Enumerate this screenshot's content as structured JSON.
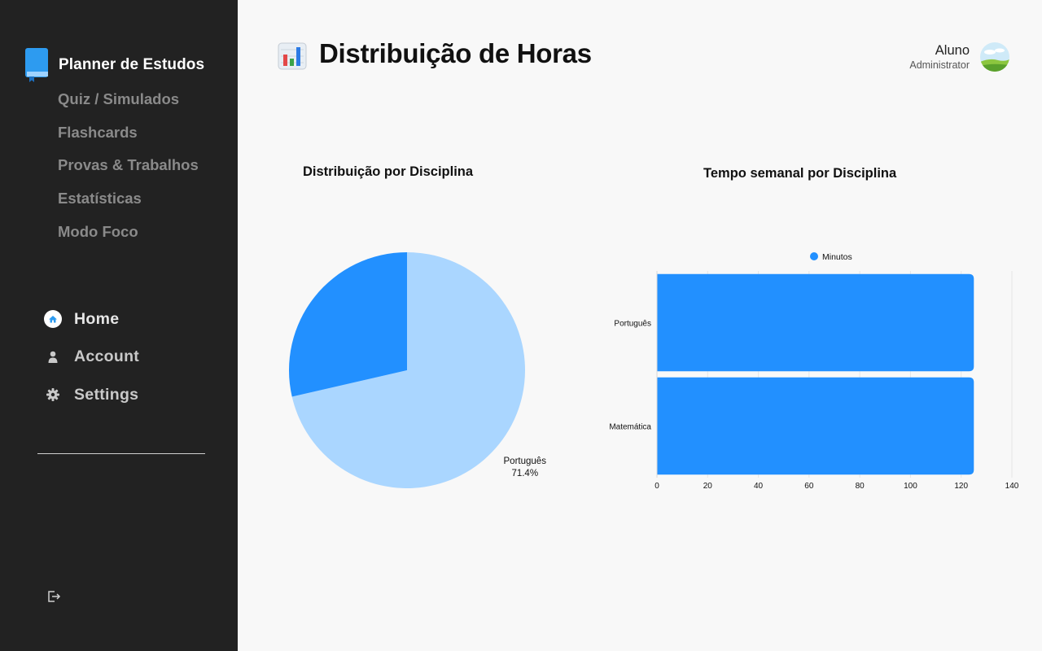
{
  "sidebar": {
    "brand": "Planner de Estudos",
    "links": [
      "Quiz / Simulados",
      "Flashcards",
      "Provas & Trabalhos",
      "Estatísticas",
      "Modo Foco"
    ],
    "nav": [
      {
        "label": "Home",
        "icon": "home-icon"
      },
      {
        "label": "Account",
        "icon": "user-icon"
      },
      {
        "label": "Settings",
        "icon": "gear-icon"
      }
    ],
    "logout_icon": "logout-icon"
  },
  "header": {
    "title": "Distribuição de Horas",
    "icon": "bar-chart-emoji-icon",
    "user_name": "Aluno",
    "user_role": "Administrator"
  },
  "charts": {
    "pie_title": "Distribuição por Disciplina",
    "bar_title": "Tempo semanal por Disciplina"
  },
  "colors": {
    "sidebar_bg": "#222222",
    "primary_blue": "#2290ff",
    "light_blue": "#aad6ff",
    "page_bg": "#f8f8f8"
  },
  "chart_data": [
    {
      "type": "pie",
      "title": "Distribuição por Disciplina",
      "categories": [
        "Português",
        "Matemática"
      ],
      "values": [
        71.4,
        28.6
      ],
      "labels": [
        "71.4%",
        "28.6%"
      ],
      "colors": [
        "#aad6ff",
        "#2290ff"
      ]
    },
    {
      "type": "bar",
      "orientation": "horizontal",
      "title": "Tempo semanal por Disciplina",
      "categories": [
        "Português",
        "Matemática"
      ],
      "series": [
        {
          "name": "Minutos",
          "values": [
            125,
            125
          ]
        }
      ],
      "xlim": [
        0,
        140
      ],
      "xticks": [
        0,
        20,
        40,
        60,
        80,
        100,
        120,
        140
      ],
      "legend": "top-center",
      "grid": true,
      "color": "#2290ff"
    }
  ]
}
